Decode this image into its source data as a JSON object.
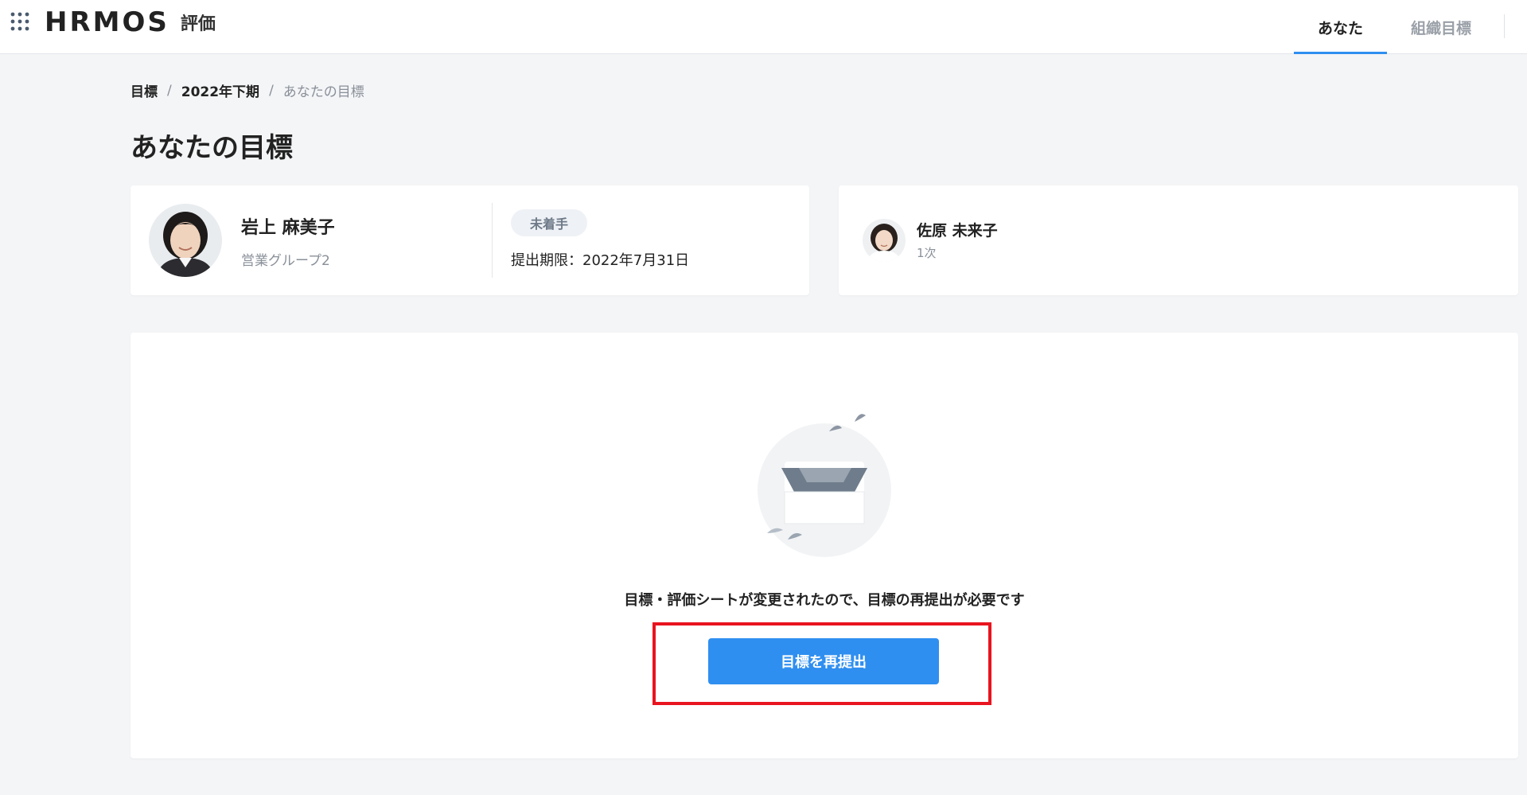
{
  "header": {
    "logo": "HRMOS",
    "product": "評価",
    "tabs": [
      {
        "label": "あなた",
        "active": true
      },
      {
        "label": "組織目標",
        "active": false
      }
    ]
  },
  "breadcrumb": [
    "目標",
    "2022年下期",
    "あなたの目標"
  ],
  "page_title": "あなたの目標",
  "user_card": {
    "name": "岩上 麻美子",
    "department": "営業グループ2",
    "status": "未着手",
    "deadline": "提出期限：2022年7月31日"
  },
  "evaluator_card": {
    "name": "佐原 未来子",
    "step": "1次"
  },
  "main": {
    "message": "目標・評価シートが変更されたので、目標の再提出が必要です",
    "button_label": "目標を再提出"
  },
  "colors": {
    "accent": "#2f8ff0",
    "highlight": "#e8141f",
    "background": "#f4f5f7"
  }
}
